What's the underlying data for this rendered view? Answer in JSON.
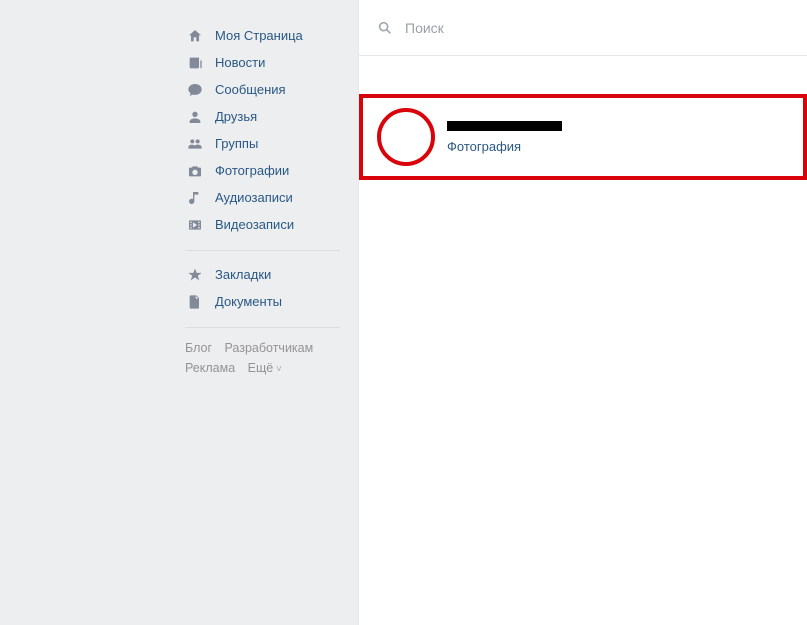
{
  "sidebar": {
    "items": [
      {
        "icon": "home-icon",
        "label": "Моя Страница"
      },
      {
        "icon": "news-icon",
        "label": "Новости"
      },
      {
        "icon": "messages-icon",
        "label": "Сообщения"
      },
      {
        "icon": "friends-icon",
        "label": "Друзья"
      },
      {
        "icon": "groups-icon",
        "label": "Группы"
      },
      {
        "icon": "photos-icon",
        "label": "Фотографии"
      },
      {
        "icon": "music-icon",
        "label": "Аудиозаписи"
      },
      {
        "icon": "videos-icon",
        "label": "Видеозаписи"
      }
    ],
    "items2": [
      {
        "icon": "bookmarks-icon",
        "label": "Закладки"
      },
      {
        "icon": "documents-icon",
        "label": "Документы"
      }
    ]
  },
  "footer": {
    "blog": "Блог",
    "developers": "Разработчикам",
    "ads": "Реклама",
    "more": "Ещё"
  },
  "search": {
    "placeholder": "Поиск"
  },
  "result": {
    "subtitle": "Фотография"
  },
  "colors": {
    "highlight": "#d9040b",
    "link": "#2a5885",
    "icon": "#828a99"
  }
}
